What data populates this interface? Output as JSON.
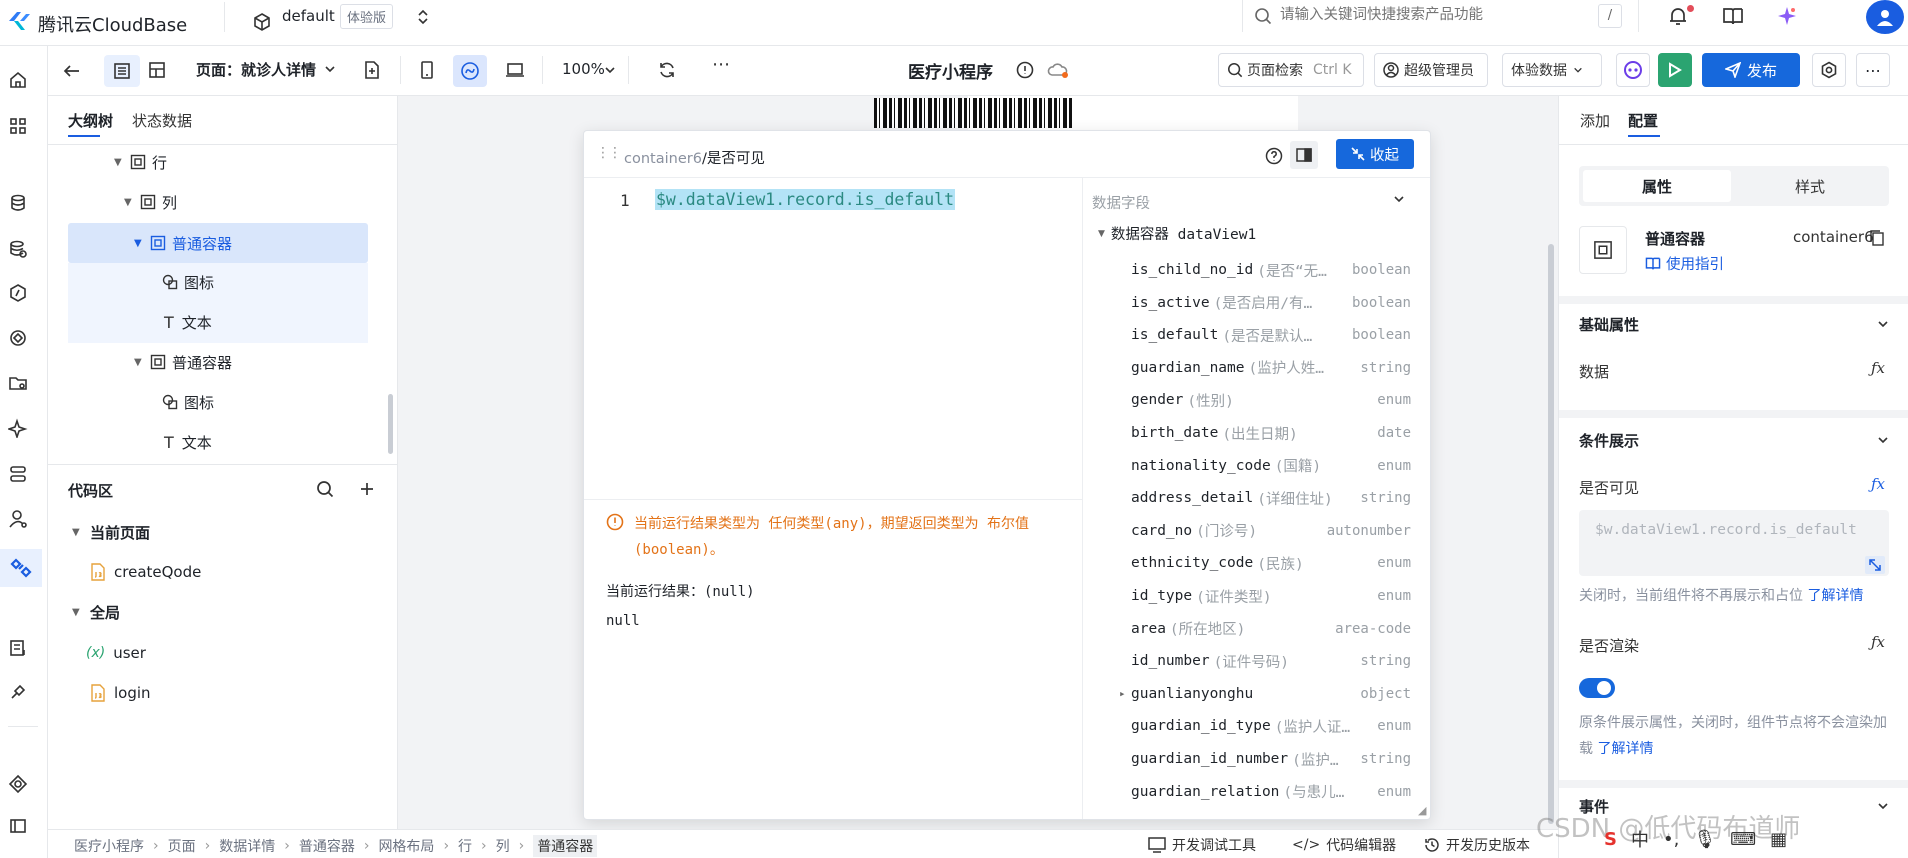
{
  "topbar": {
    "brand": "腾讯云CloudBase",
    "env_name": "default",
    "env_badge": "体验版",
    "search_placeholder": "请输入关键词快捷搜索产品功能",
    "search_shortcut": "/"
  },
  "toolbar": {
    "page_label": "页面：就诊人详情",
    "zoom": "100%",
    "app_title": "医疗小程序",
    "page_search": "页面检索",
    "page_search_shortcut": "Ctrl K",
    "role": "超级管理员",
    "data_mode": "体验数据",
    "publish": "发布"
  },
  "left_panel": {
    "tabs": [
      "大纲树",
      "状态数据"
    ],
    "tree": [
      {
        "label": "行"
      },
      {
        "label": "列"
      },
      {
        "label": "普通容器"
      },
      {
        "label": "图标"
      },
      {
        "label": "文本"
      },
      {
        "label": "普通容器"
      },
      {
        "label": "图标"
      },
      {
        "label": "文本"
      }
    ],
    "code_section_title": "代码区",
    "current_page_label": "当前页面",
    "current_page_items": [
      "createQode"
    ],
    "global_label": "全局",
    "global_items": [
      {
        "prefix": "(x)",
        "label": "user"
      },
      {
        "label": "login"
      }
    ]
  },
  "editor": {
    "breadcrumb_root": "container6",
    "breadcrumb_leaf": "/是否可见",
    "collapse_button": "收起",
    "line_number": "1",
    "code": "$w.dataView1.record.is_default",
    "warning": "当前运行结果类型为 任何类型(any)，期望返回类型为 布尔值(boolean)。",
    "result_label": "当前运行结果：(null)",
    "result_value": "null",
    "fields_title": "数据字段",
    "container_label": "数据容器 dataView1",
    "fields": [
      {
        "name": "is_child_no_id",
        "desc": "(是否“无…",
        "type": "boolean"
      },
      {
        "name": "is_active",
        "desc": "(是否启用/有…",
        "type": "boolean"
      },
      {
        "name": "is_default",
        "desc": "(是否是默认…",
        "type": "boolean"
      },
      {
        "name": "guardian_name",
        "desc": "(监护人姓…",
        "type": "string"
      },
      {
        "name": "gender",
        "desc": "(性别)",
        "type": "enum"
      },
      {
        "name": "birth_date",
        "desc": "(出生日期)",
        "type": "date"
      },
      {
        "name": "nationality_code",
        "desc": "(国籍)",
        "type": "enum"
      },
      {
        "name": "address_detail",
        "desc": "(详细住址)",
        "type": "string"
      },
      {
        "name": "card_no",
        "desc": "(门诊号)",
        "type": "autonumber"
      },
      {
        "name": "ethnicity_code",
        "desc": "(民族)",
        "type": "enum"
      },
      {
        "name": "id_type",
        "desc": "(证件类型)",
        "type": "enum"
      },
      {
        "name": "area",
        "desc": "(所在地区)",
        "type": "area-code"
      },
      {
        "name": "id_number",
        "desc": "(证件号码)",
        "type": "string"
      },
      {
        "name": "guanlianyonghu",
        "desc": "",
        "type": "object"
      },
      {
        "name": "guardian_id_type",
        "desc": "(监护人证…",
        "type": "enum"
      },
      {
        "name": "guardian_id_number",
        "desc": "(监护…",
        "type": "string"
      },
      {
        "name": "guardian_relation",
        "desc": "(与患儿…",
        "type": "enum"
      }
    ]
  },
  "right_panel": {
    "tabs": [
      "添加",
      "配置"
    ],
    "sub_tabs": [
      "属性",
      "样式"
    ],
    "component_name": "普通容器",
    "component_id": "container6",
    "usage_guide": "使用指引",
    "basic_props": "基础属性",
    "data_label": "数据",
    "condition_title": "条件展示",
    "visible_label": "是否可见",
    "visible_code": "$w.dataView1.record.is_default",
    "visible_hint": "关闭时，当前组件将不再展示和占位",
    "learn_more": "了解详情",
    "render_label": "是否渲染",
    "render_toggle": true,
    "render_hint": "原条件展示属性，关闭时，组件节点将不会渲染加载",
    "events_title": "事件"
  },
  "statusbar": {
    "breadcrumbs": [
      "医疗小程序",
      "页面",
      "数据详情",
      "普通容器",
      "网格布局",
      "行",
      "列",
      "普通容器"
    ],
    "debug_tools": "开发调试工具",
    "code_editor": "代码编辑器",
    "history": "开发历史版本"
  },
  "watermark": "CSDN @低代码布道师",
  "colors": {
    "accent": "#1a5de0",
    "publish": "#1668dc",
    "run": "#2ba471",
    "warning": "#e37318"
  }
}
